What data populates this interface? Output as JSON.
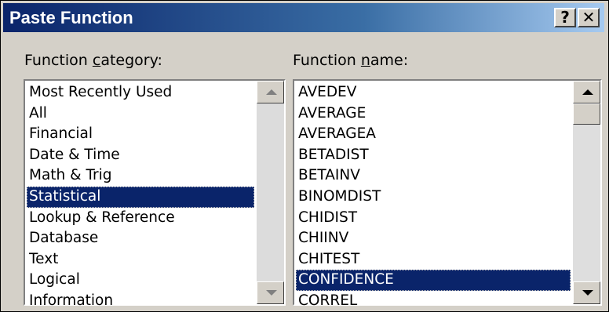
{
  "window": {
    "title": "Paste Function",
    "help_glyph": "?",
    "close_glyph": "✕"
  },
  "category": {
    "label_pre": "Function ",
    "label_accel": "c",
    "label_post": "ategory:",
    "items": [
      "Most Recently Used",
      "All",
      "Financial",
      "Date & Time",
      "Math & Trig",
      "Statistical",
      "Lookup & Reference",
      "Database",
      "Text",
      "Logical",
      "Information"
    ],
    "selected": "Statistical"
  },
  "function": {
    "label_pre": "Function ",
    "label_accel": "n",
    "label_post": "ame:",
    "items": [
      "AVEDEV",
      "AVERAGE",
      "AVERAGEA",
      "BETADIST",
      "BETAINV",
      "BINOMDIST",
      "CHIDIST",
      "CHIINV",
      "CHITEST",
      "CONFIDENCE",
      "CORREL"
    ],
    "selected": "CONFIDENCE"
  }
}
